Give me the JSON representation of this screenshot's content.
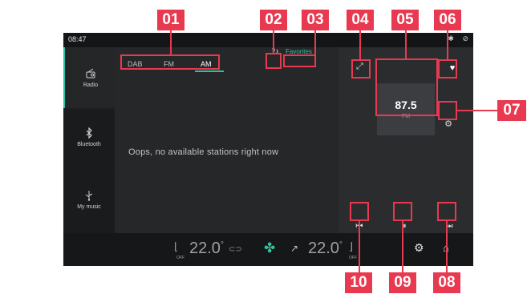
{
  "status_bar": {
    "time": "08:47",
    "icons": [
      "bluetooth-icon",
      "link-icon"
    ]
  },
  "sidebar": {
    "items": [
      {
        "label": "Radio",
        "icon": "radio-icon",
        "active": true
      },
      {
        "label": "Bluetooth",
        "icon": "bluetooth-icon",
        "active": false
      },
      {
        "label": "My music",
        "icon": "usb-icon",
        "active": false
      }
    ]
  },
  "tabs": [
    "DAB",
    "FM",
    "AM"
  ],
  "active_tab": "AM",
  "favorites_label": "Favorites",
  "empty_message": "Oops, no available stations right now",
  "now_playing": {
    "frequency": "87.5",
    "band": "FM"
  },
  "climate": {
    "left": {
      "seat_status": "OFF",
      "temperature": "22.0",
      "unit": "°"
    },
    "right": {
      "seat_status": "OFF",
      "temperature": "22.0",
      "unit": "°"
    }
  },
  "callouts": [
    "01",
    "02",
    "03",
    "04",
    "05",
    "06",
    "07",
    "08",
    "09",
    "10"
  ],
  "colors": {
    "accent": "#29c2a6",
    "callout": "#e83950",
    "fan": "#2fc29b"
  }
}
